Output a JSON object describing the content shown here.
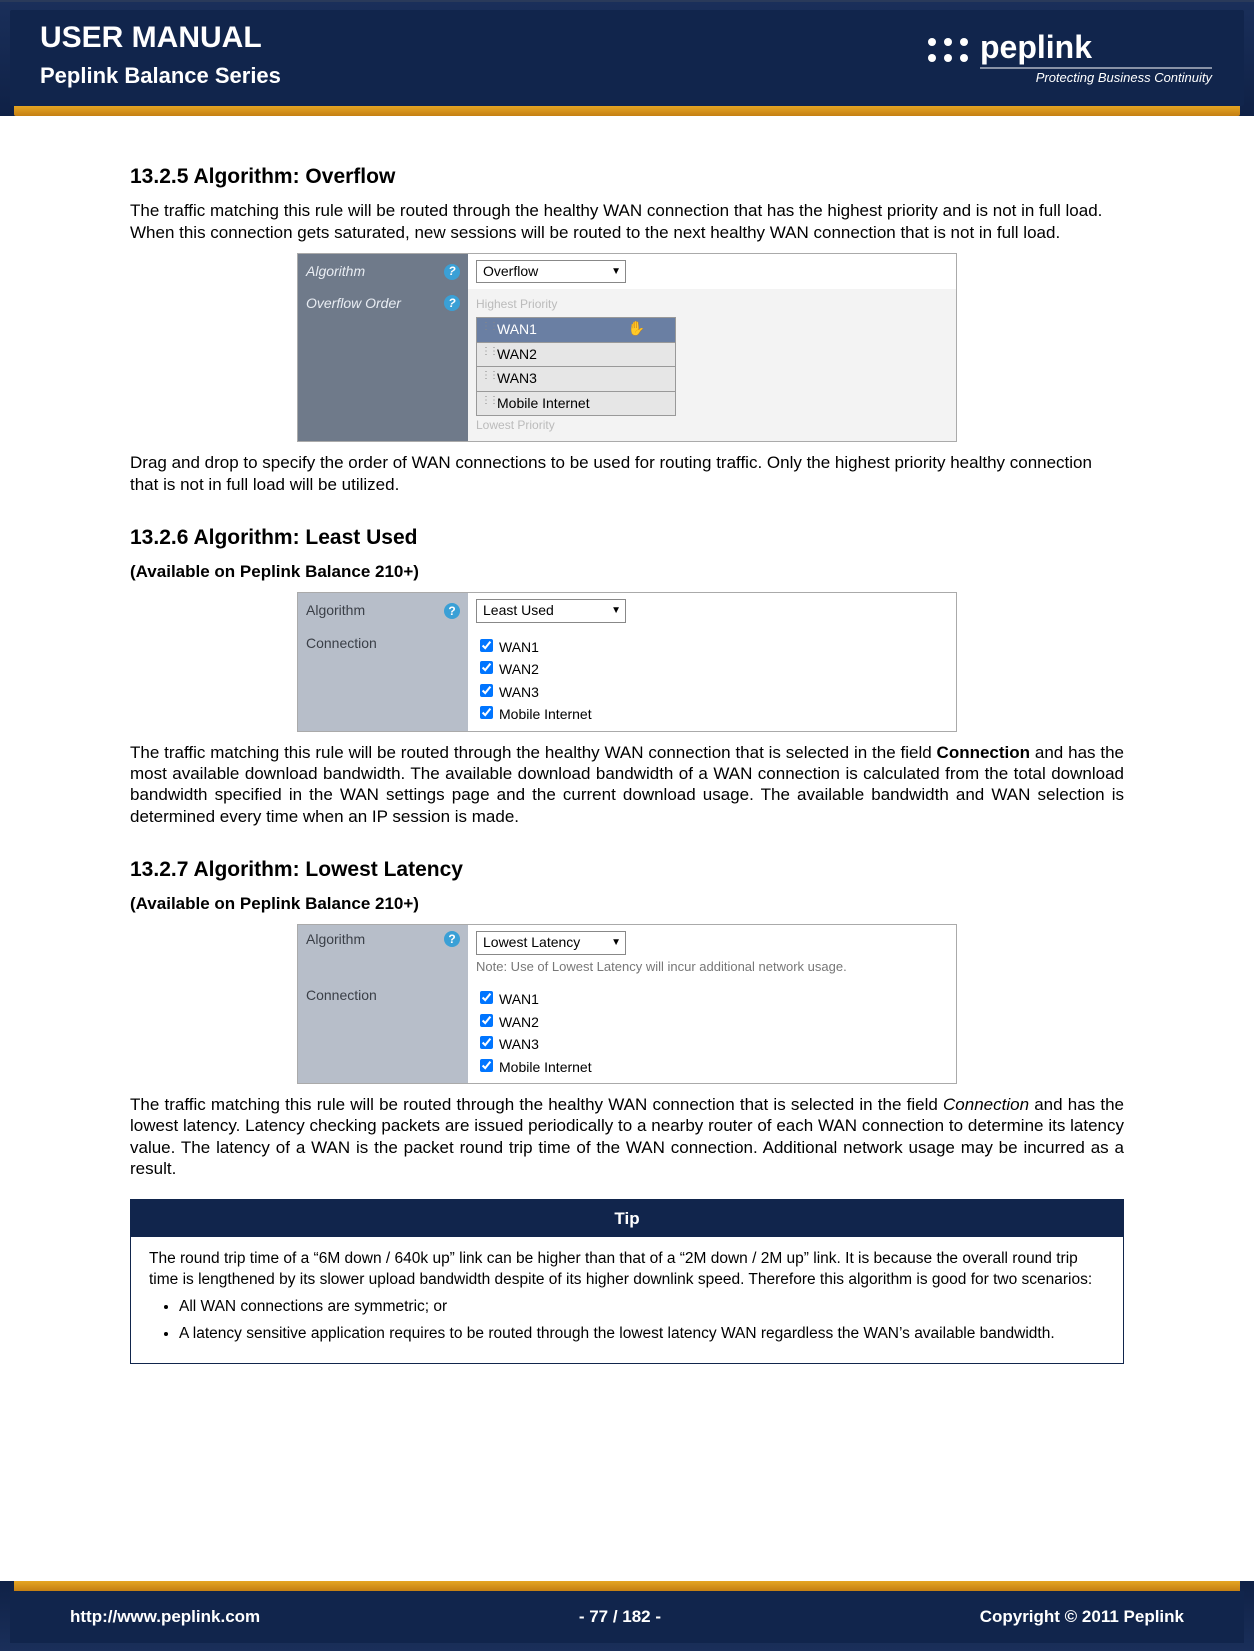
{
  "header": {
    "title": "USER MANUAL",
    "subtitle": "Peplink Balance Series",
    "brand_name": "peplink",
    "tagline": "Protecting Business Continuity",
    "brand_accent": "#e5a523",
    "header_bg": "#11254c"
  },
  "section1": {
    "heading": "13.2.5 Algorithm: Overflow",
    "para1": "The traffic matching this rule will be routed through the healthy WAN connection that has the highest priority and is not in full load. When this connection gets saturated, new sessions will be routed to the next healthy WAN connection that is not in full load.",
    "cfg": {
      "algorithm_label": "Algorithm",
      "algorithm_value": "Overflow",
      "order_label": "Overflow Order",
      "highest": "Highest Priority",
      "lowest": "Lowest Priority",
      "items": [
        "WAN1",
        "WAN2",
        "WAN3",
        "Mobile Internet"
      ]
    },
    "para2": "Drag and drop to specify the order of WAN connections to be used for routing traffic. Only the highest priority healthy connection that is not in full load will be utilized."
  },
  "section2": {
    "heading": "13.2.6 Algorithm: Least Used",
    "avail": "(Available on Peplink Balance 210+)",
    "cfg": {
      "algorithm_label": "Algorithm",
      "algorithm_value": "Least Used",
      "connection_label": "Connection",
      "checks": [
        "WAN1",
        "WAN2",
        "WAN3",
        "Mobile Internet"
      ]
    },
    "para_a": "The traffic matching this rule will be routed through the healthy WAN connection that is selected in the field ",
    "para_bold": "Connection",
    "para_b": " and has the most available download bandwidth.  The available download bandwidth of a WAN connection is calculated from the total download bandwidth specified in the WAN settings page and the current download usage.  The available bandwidth and WAN selection is determined every time when an IP session is made."
  },
  "section3": {
    "heading": "13.2.7 Algorithm: Lowest Latency",
    "avail": "(Available on Peplink Balance 210+)",
    "cfg": {
      "algorithm_label": "Algorithm",
      "algorithm_value": "Lowest Latency",
      "note": "Note: Use of Lowest Latency will incur additional network usage.",
      "connection_label": "Connection",
      "checks": [
        "WAN1",
        "WAN2",
        "WAN3",
        "Mobile Internet"
      ]
    },
    "para_a": "The traffic matching this rule will be routed through the healthy WAN connection that is selected in the field ",
    "para_italic": "Connection",
    "para_b": " and has the lowest latency.  Latency checking packets are issued periodically to a nearby router of each WAN connection to determine its latency value.  The latency of a WAN is the packet round trip time of the WAN connection.  Additional network usage may be incurred as a result."
  },
  "tip": {
    "title": "Tip",
    "text1": "The round trip time of a “6M down / 640k up” link can be higher than that of a “2M down / 2M up” link.  It is because the overall round trip time is lengthened by its slower upload bandwidth despite of its higher downlink speed.  Therefore this algorithm is good for two scenarios:",
    "bullets": [
      "All WAN connections are symmetric; or",
      "A latency sensitive application requires to be routed through the lowest latency WAN regardless the WAN’s available bandwidth."
    ]
  },
  "footer": {
    "url": "http://www.peplink.com",
    "page": "- 77 / 182 -",
    "copyright": "Copyright © 2011 Peplink"
  }
}
